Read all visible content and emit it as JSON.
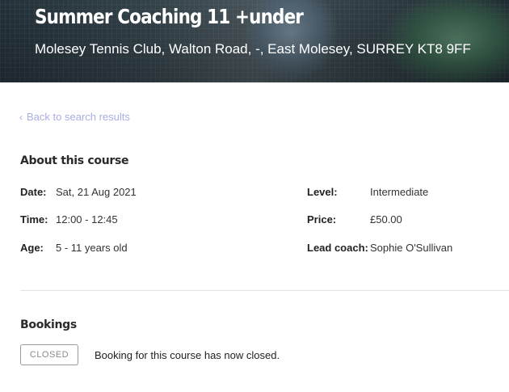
{
  "hero": {
    "title": "Summer Coaching 11 +under",
    "address": "Molesey Tennis Club, Walton Road, -, East Molesey, SURREY KT8 9FF"
  },
  "nav": {
    "back_label": "Back to search results"
  },
  "about": {
    "title": "About this course",
    "date_label": "Date:",
    "date_value": "Sat, 21 Aug 2021",
    "time_label": "Time:",
    "time_value": "12:00 - 12:45",
    "age_label": "Age:",
    "age_value": "5 - 11 years old",
    "level_label": "Level:",
    "level_value": "Intermediate",
    "price_label": "Price:",
    "price_value": "£50.00",
    "coach_label": "Lead coach:",
    "coach_value": "Sophie O'Sullivan"
  },
  "bookings": {
    "title": "Bookings",
    "status": "CLOSED",
    "message": "Booking for this course has now closed."
  },
  "colors": {
    "link": "#a9aee0",
    "badge_border": "#9a9a9a"
  }
}
